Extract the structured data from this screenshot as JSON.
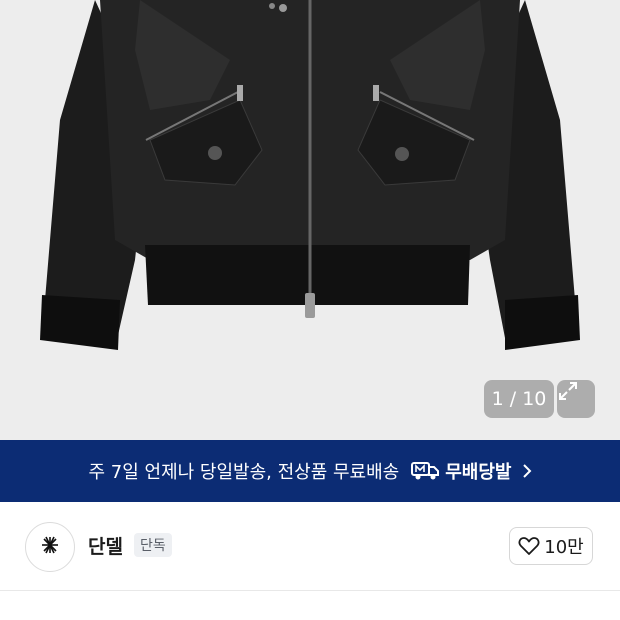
{
  "gallery": {
    "image_alt": "black bomber jacket product photo",
    "counter": "1 / 10",
    "expand_icon": "expand-icon"
  },
  "banner": {
    "text": "주 7일 언제나 당일발송, 전상품 무료배송",
    "badge_label": "무배당발",
    "badge_icon": "delivery-truck-icon",
    "arrow_icon": "chevron-right-icon",
    "background": "#0c2c74"
  },
  "shop": {
    "name": "단델",
    "tag": "단독",
    "logo_icon": "shop-logo-icon",
    "like_count": "10만",
    "like_icon": "heart-icon"
  }
}
